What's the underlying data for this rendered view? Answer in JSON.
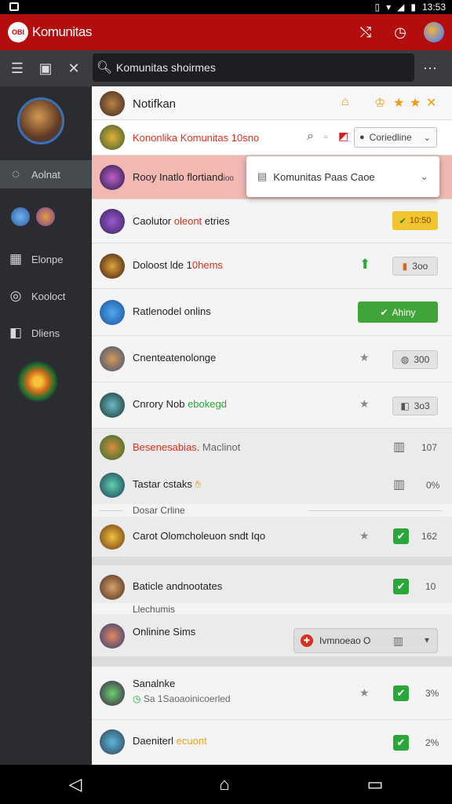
{
  "statusbar": {
    "time": "13:53"
  },
  "appbar": {
    "logo_text": "OBI",
    "title": "Komunitas"
  },
  "toolbar": {
    "search_value": "Komunitas shoirmes"
  },
  "sidebar": {
    "items": [
      {
        "label": "Aolnat",
        "icon": "chat-bubble-icon"
      },
      {
        "label": "Elonpe",
        "icon": "grid-icon"
      },
      {
        "label": "Kooloct",
        "icon": "clock-icon"
      },
      {
        "label": "Dliens",
        "icon": "box-icon"
      }
    ]
  },
  "header": {
    "title": "Notifkan"
  },
  "filter": {
    "text": "Kononlika Komunitas 10sno",
    "select_value": "Coriedline"
  },
  "popup": {
    "label": "Komunitas Paas Caoe"
  },
  "rows": [
    {
      "title": "Rooy Inatlo flortiand",
      "title_suffix": "ioo"
    },
    {
      "title": "Caolutor ",
      "title_accent": "oleont",
      "title_end": " etries",
      "badge": "10:50"
    },
    {
      "title": "Doloost lde 1",
      "title_accent": "0hems",
      "chip": "3oo"
    },
    {
      "title": "Ratlenodel onlins",
      "button": "Ahiny"
    },
    {
      "title": "Cnenteatenolonge",
      "chip": "300"
    },
    {
      "title": "Cnrory Nob ",
      "title_green": "ebokegd",
      "chip": "3o3"
    },
    {
      "title": "Besenesabias.",
      "title_gray": " Maclinot",
      "count": "107"
    },
    {
      "title": "Tastar cstaks",
      "count": "0%"
    },
    {
      "label": "Dosar Crline"
    },
    {
      "title": "Carot Olomcholeuon sndt Iqo",
      "count": "162"
    },
    {
      "title": "Baticle andnootates",
      "count": "10"
    },
    {
      "label": "Llechumis"
    },
    {
      "title": "Onlinine Sims",
      "dropdown": "Ivmnoeao O"
    },
    {
      "title": "Sanalnke",
      "sub": "Sa 1Saoaoinicoerled",
      "count": "3%"
    },
    {
      "title": "Daeniterl",
      "title_accent": "ecuont",
      "count": "2%"
    }
  ]
}
